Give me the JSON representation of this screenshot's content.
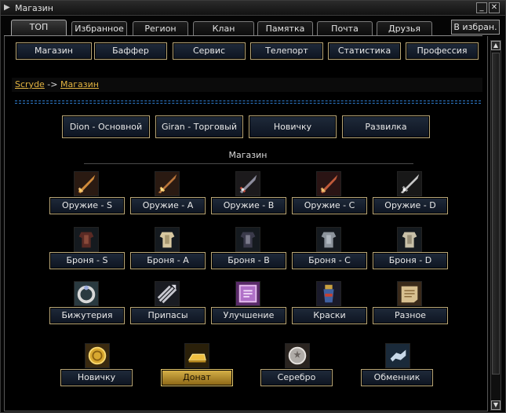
{
  "window": {
    "title": "Магазин"
  },
  "title_buttons": {
    "minimize": "_",
    "close": "✕"
  },
  "tabs": [
    {
      "label": "ТОП",
      "active": true
    },
    {
      "label": "Избранное"
    },
    {
      "label": "Регион"
    },
    {
      "label": "Клан"
    },
    {
      "label": "Памятка"
    },
    {
      "label": "Почта"
    },
    {
      "label": "Друзья"
    }
  ],
  "favorite_button": "В избран.",
  "nav": [
    "Магазин",
    "Баффер",
    "Сервис",
    "Телепорт",
    "Статистика",
    "Профессия"
  ],
  "breadcrumb": {
    "first": "Scryde",
    "separator": " -> ",
    "second": "Магазин"
  },
  "servers": [
    "Dion - Основной",
    "Giran - Торговый",
    "Новичку",
    "Развилка"
  ],
  "section_title": "Магазин",
  "weapons": [
    "Оружие - S",
    "Оружие - A",
    "Оружие - B",
    "Оружие - C",
    "Оружие - D"
  ],
  "armor": [
    "Броня - S",
    "Броня - A",
    "Броня - B",
    "Броня - C",
    "Броня - D"
  ],
  "misc": [
    "Бижутерия",
    "Припасы",
    "Улучшение",
    "Краски",
    "Разное"
  ],
  "bottom": [
    "Новичку",
    "Донат",
    "Серебро",
    "Обменник"
  ],
  "scroll": {
    "up": "▲",
    "down": "▼"
  },
  "colors": {
    "link": "#e2b341",
    "frame": "#b9a778",
    "dashed_line": "#2f7fd1",
    "highlight": "#d8b34a"
  },
  "icons": {
    "weapons": [
      "sword-icon",
      "sword-icon",
      "sword-icon",
      "sword-icon",
      "sword-icon"
    ],
    "armor": [
      "armor-icon",
      "armor-icon",
      "armor-icon",
      "armor-icon",
      "armor-icon"
    ],
    "misc": [
      "ring-icon",
      "arrows-icon",
      "scroll-icon",
      "paint-icon",
      "map-icon"
    ],
    "bottom": [
      "coin-icon",
      "gold-bar-icon",
      "silver-coin-icon",
      "exchange-icon"
    ]
  }
}
